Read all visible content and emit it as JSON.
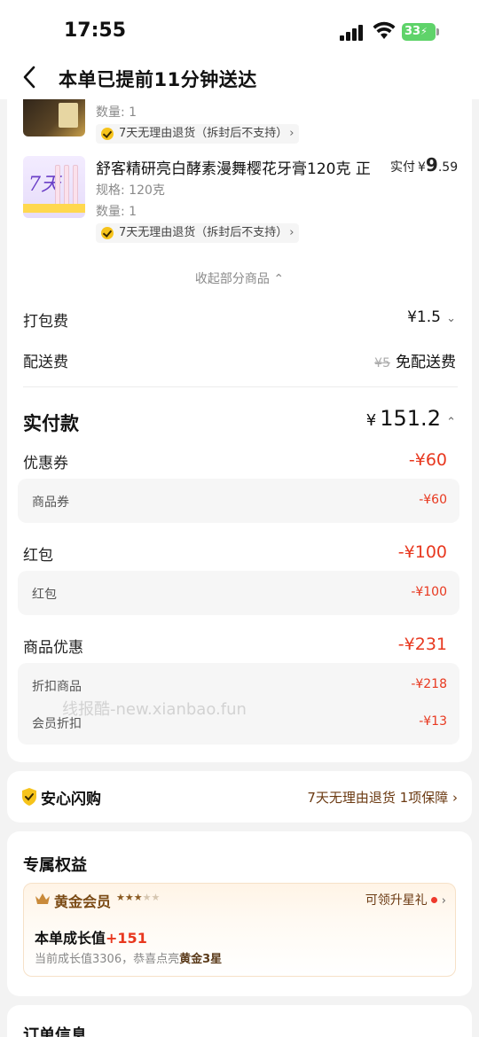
{
  "status": {
    "time": "17:55",
    "battery": "33"
  },
  "nav": {
    "title": "本单已提前11分钟送达"
  },
  "items": [
    {
      "qty": "数量: 1",
      "return_tag": "7天无理由退货（拆封后不支持）"
    },
    {
      "name": "舒客精研亮白酵素漫舞樱花牙膏120克 正",
      "paid_label": "实付",
      "paid_yen": "¥",
      "paid_int": "9",
      "paid_dec": ".59",
      "spec": "规格: 120克",
      "qty": "数量: 1",
      "return_tag": "7天无理由退货（拆封后不支持）",
      "thumb_text": "7天"
    }
  ],
  "collapse": {
    "label": "收起部分商品 ⌃"
  },
  "fees": {
    "packing_label": "打包费",
    "packing_value": "¥1.5",
    "delivery_label": "配送费",
    "delivery_original": "¥5",
    "delivery_value": "免配送费"
  },
  "total": {
    "label": "实付款",
    "yen": "¥",
    "value": "151.2"
  },
  "discounts": [
    {
      "label": "优惠券",
      "value": "-¥60",
      "details": [
        {
          "label": "商品券",
          "value": "-¥60"
        }
      ]
    },
    {
      "label": "红包",
      "value": "-¥100",
      "details": [
        {
          "label": "红包",
          "value": "-¥100"
        }
      ]
    },
    {
      "label": "商品优惠",
      "value": "-¥231",
      "details": [
        {
          "label": "折扣商品",
          "value": "-¥218"
        },
        {
          "label": "会员折扣",
          "value": "-¥13"
        }
      ]
    }
  ],
  "watermark": "线报酷-new.xianbao.fun",
  "assurance": {
    "title": "安心闪购",
    "right": "7天无理由退货 1项保障 ›"
  },
  "benefits": {
    "title": "专属权益",
    "member_name": "黄金会员",
    "stars_filled": 3,
    "stars_total": 5,
    "gift_label": "可领升星礼",
    "growth_label": "本单成长值",
    "growth_value": "+151",
    "growth_sub_prefix": "当前成长值3306，恭喜点亮",
    "growth_sub_level": "黄金3星"
  },
  "order": {
    "title": "订单信息"
  },
  "colors": {
    "accent_red": "#e8381f",
    "gold_brown": "#7a4a14",
    "battery_green": "#5fd36a"
  }
}
